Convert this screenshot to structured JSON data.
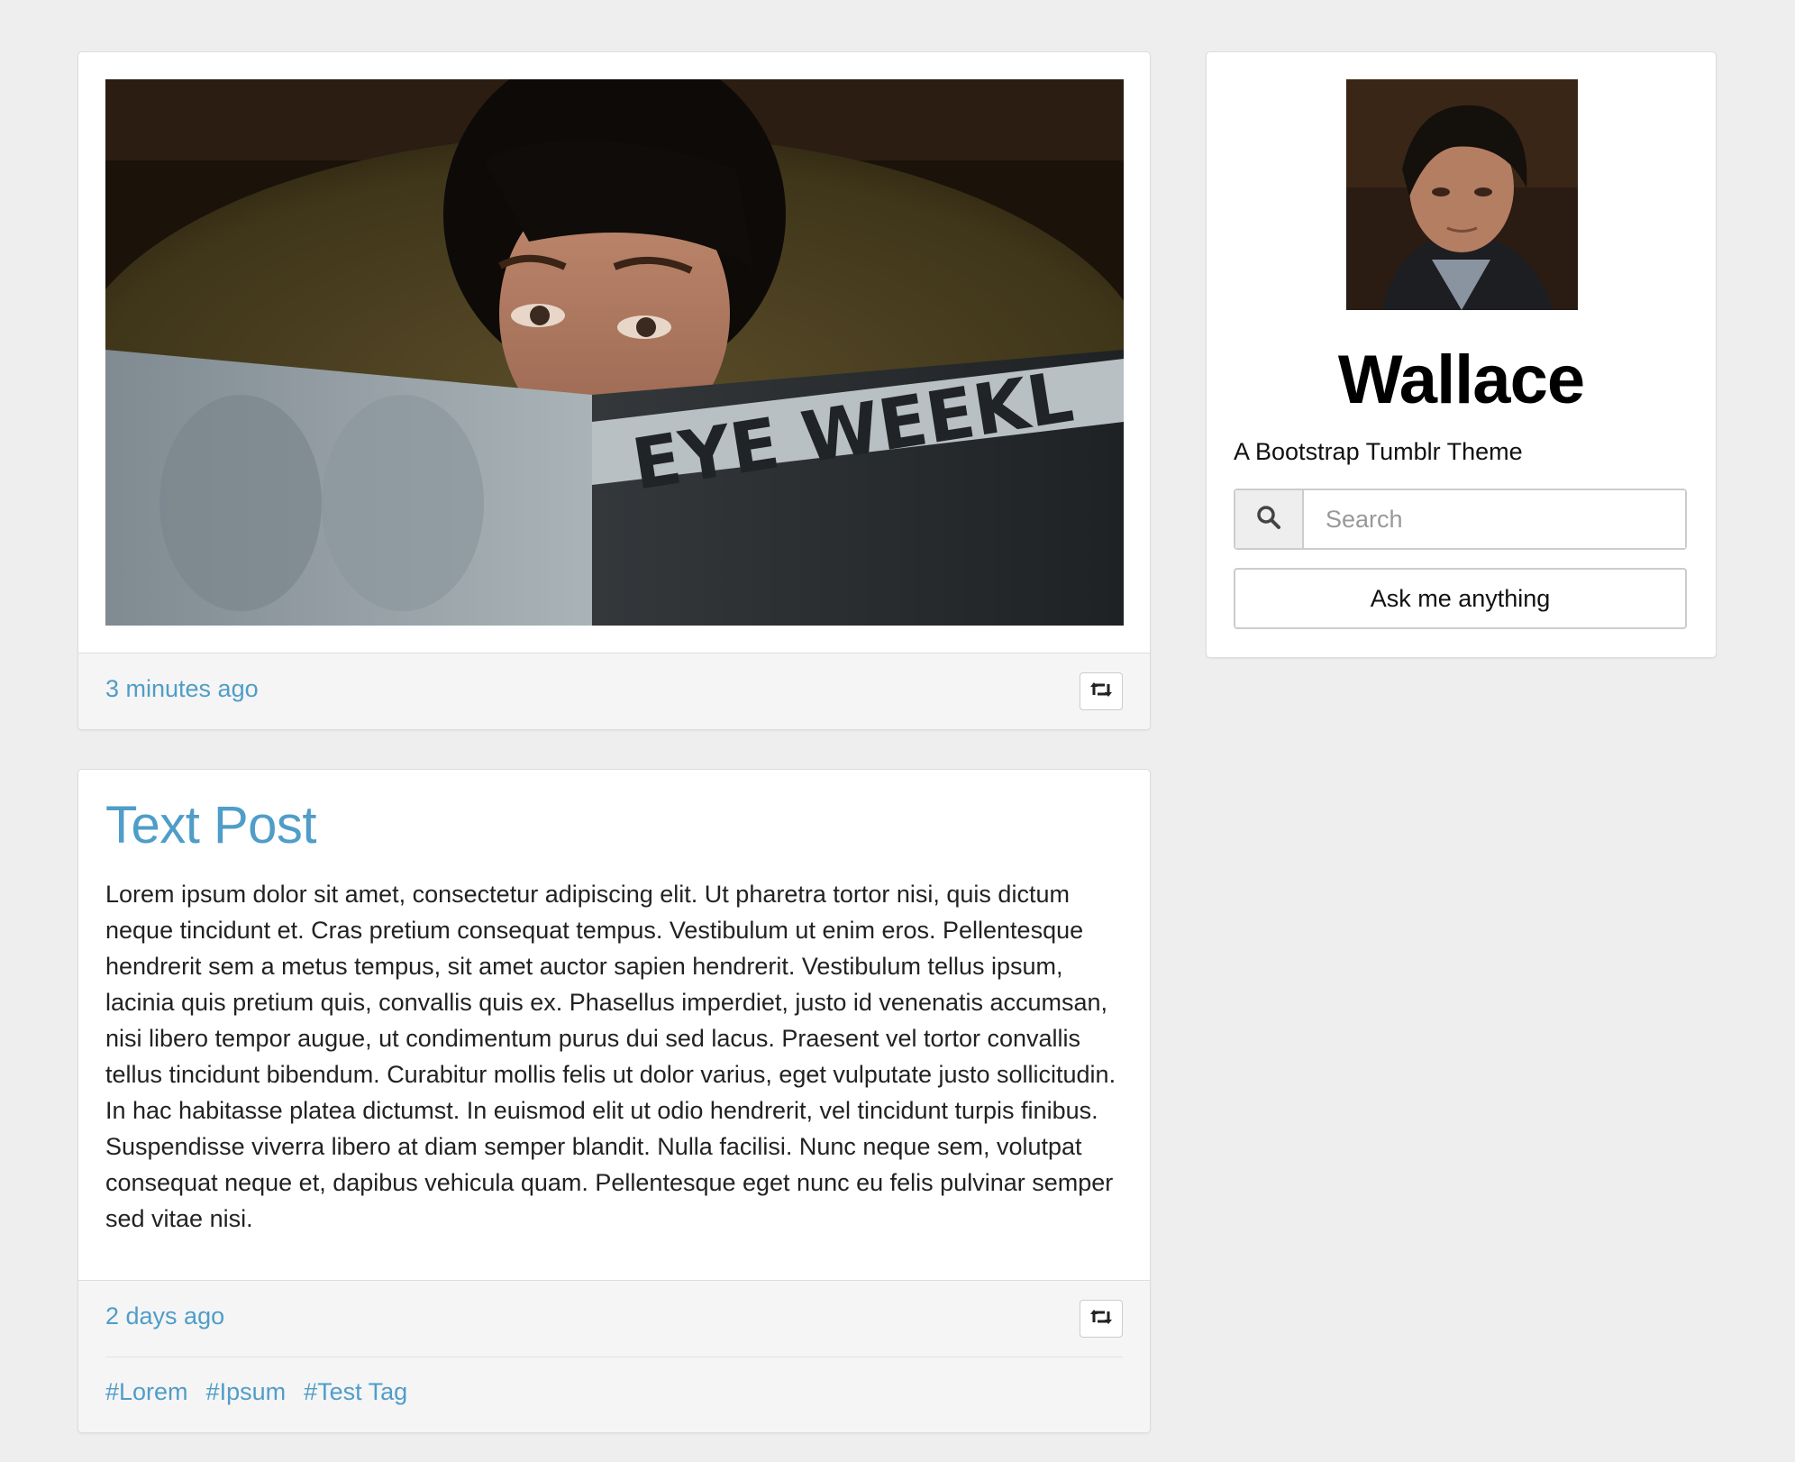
{
  "posts": [
    {
      "type": "photo",
      "photo_icon": "photo-image",
      "timestamp": "3 minutes ago",
      "reblog_icon": "retweet-icon"
    },
    {
      "type": "text",
      "title": "Text Post",
      "body": "Lorem ipsum dolor sit amet, consectetur adipiscing elit. Ut pharetra tortor nisi, quis dictum neque tincidunt et. Cras pretium consequat tempus. Vestibulum ut enim eros. Pellentesque hendrerit sem a metus tempus, sit amet auctor sapien hendrerit. Vestibulum tellus ipsum, lacinia quis pretium quis, convallis quis ex. Phasellus imperdiet, justo id venenatis accumsan, nisi libero tempor augue, ut condimentum purus dui sed lacus. Praesent vel tortor convallis tellus tincidunt bibendum. Curabitur mollis felis ut dolor varius, eget vulputate justo sollicitudin. In hac habitasse platea dictumst. In euismod elit ut odio hendrerit, vel tincidunt turpis finibus. Suspendisse viverra libero at diam semper blandit. Nulla facilisi. Nunc neque sem, volutpat consequat neque et, dapibus vehicula quam. Pellentesque eget nunc eu felis pulvinar semper sed vitae nisi.",
      "timestamp": "2 days ago",
      "reblog_icon": "retweet-icon",
      "tags": [
        "#Lorem",
        "#Ipsum",
        "#Test Tag"
      ]
    }
  ],
  "photo_text": "EYE WEEKL",
  "sidebar": {
    "title": "Wallace",
    "description": "A Bootstrap Tumblr Theme",
    "search_placeholder": "Search",
    "search_icon": "search-icon",
    "ask_label": "Ask me anything"
  },
  "colors": {
    "background": "#eeeeee",
    "link": "#4f9dc8",
    "card": "#ffffff",
    "footer": "#f5f5f5"
  }
}
